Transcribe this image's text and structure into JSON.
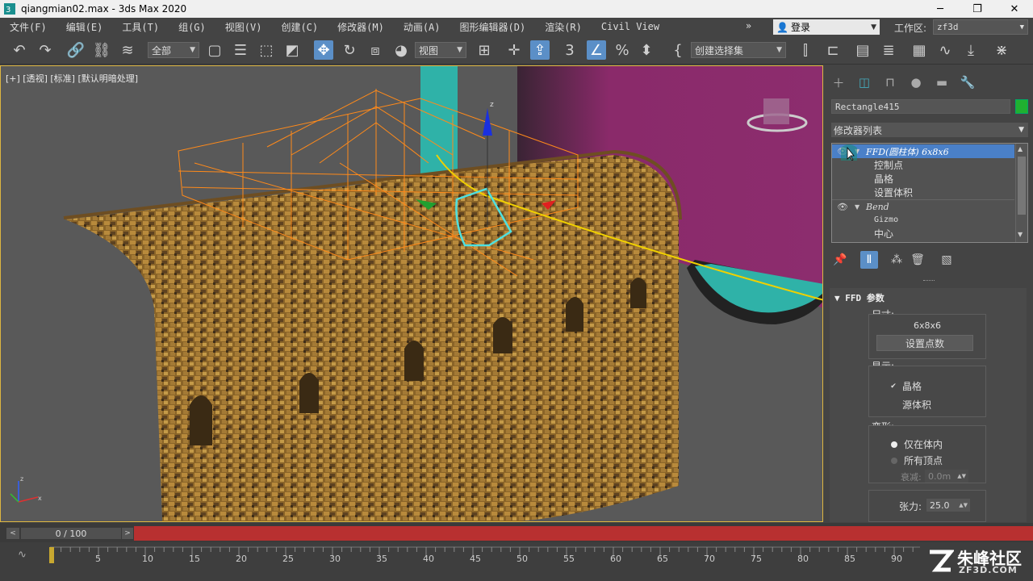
{
  "window": {
    "title": "qiangmian02.max - 3ds Max 2020",
    "minimize": "─",
    "maximize": "❐",
    "close": "✕"
  },
  "menu": {
    "items": [
      "文件(F)",
      "编辑(E)",
      "工具(T)",
      "组(G)",
      "视图(V)",
      "创建(C)",
      "修改器(M)",
      "动画(A)",
      "图形编辑器(D)",
      "渲染(R)",
      "Civil View"
    ],
    "more": "»",
    "login": "登录",
    "workspace_label": "工作区:",
    "workspace_value": "zf3d"
  },
  "toolbar": {
    "filter_value": "全部",
    "coord_value": "视图",
    "selection_set": "创建选择集",
    "icons": [
      "undo-icon",
      "redo-icon",
      "link-icon",
      "unlink-icon",
      "bind-space-warp-icon",
      "select-object-icon",
      "select-by-name-icon",
      "rectangular-region-icon",
      "window-crossing-icon",
      "move-icon",
      "rotate-icon",
      "scale-icon",
      "place-icon",
      "pivot-icon",
      "snap-3d-icon",
      "angle-snap-icon",
      "percent-snap-icon",
      "spinner-snap-icon",
      "named-selection-icon",
      "mirror-icon",
      "align-icon",
      "scene-explorer-icon",
      "layer-icon",
      "ribbon-icon",
      "curve-editor-icon",
      "schematic-icon",
      "material-editor-icon"
    ]
  },
  "viewport": {
    "label": "[+] [透视] [标准] [默认明暗处理]",
    "axis_x": "x",
    "axis_z": "z",
    "gizmo_z": "z"
  },
  "command_panel": {
    "object_name": "Rectangle415",
    "object_color": "#20b030",
    "modifier_list": "修改器列表",
    "stack": [
      {
        "label": "FFD(圆柱体) 6x8x6",
        "type": "modifier",
        "selected": true
      },
      {
        "label": "控制点",
        "type": "sub"
      },
      {
        "label": "晶格",
        "type": "sub"
      },
      {
        "label": "设置体积",
        "type": "sub"
      },
      {
        "label": "Bend",
        "type": "modifier",
        "selected": false
      },
      {
        "label": "Gizmo",
        "type": "sub"
      },
      {
        "label": "中心",
        "type": "sub"
      }
    ],
    "ffd": {
      "title": "FFD 参数",
      "size_label": "尺寸:",
      "size_value": "6x8x6",
      "set_points": "设置点数",
      "display_label": "显示:",
      "lattice": "晶格",
      "lattice_checked": true,
      "source_volume": "源体积",
      "source_volume_checked": false,
      "deform_label": "变形:",
      "only_in_volume": "仅在体内",
      "all_vertices": "所有顶点",
      "falloff_label": "衰减:",
      "falloff_value": "0.0m",
      "tension_label": "张力:",
      "tension_value": "25.0"
    }
  },
  "timeline": {
    "frame": "0 / 100",
    "prev": "<",
    "next": ">",
    "ticks": [
      "5",
      "10",
      "15",
      "20",
      "25",
      "30",
      "35",
      "40",
      "45",
      "50",
      "55",
      "60",
      "65",
      "70",
      "75",
      "80",
      "85",
      "90"
    ]
  },
  "watermark": {
    "main": "朱峰社区",
    "sub": "ZF3D.COM"
  }
}
